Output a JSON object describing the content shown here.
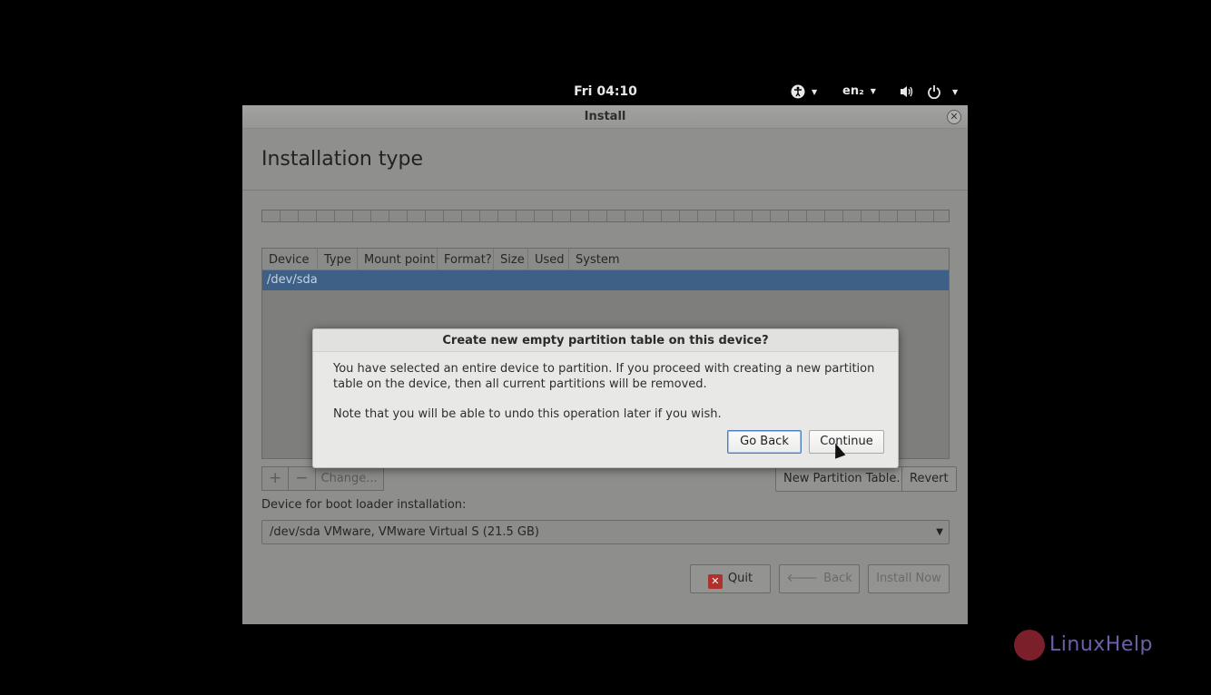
{
  "topbar": {
    "clock": "Fri 04:10",
    "language": "en₂",
    "icons": [
      "accessibility-icon",
      "volume-icon",
      "power-icon"
    ]
  },
  "window": {
    "title": "Install",
    "page_title": "Installation type"
  },
  "partition_table": {
    "columns": [
      "Device",
      "Type",
      "Mount point",
      "Format?",
      "Size",
      "Used",
      "System"
    ],
    "rows": [
      "/dev/sda"
    ]
  },
  "table_buttons": {
    "add": "+",
    "remove": "−",
    "change": "Change...",
    "new_partition_table": "New Partition Table...",
    "revert": "Revert"
  },
  "boot_loader": {
    "label": "Device for boot loader installation:",
    "selected": "/dev/sda  VMware, VMware Virtual S (21.5 GB)"
  },
  "nav_buttons": {
    "quit": "Quit",
    "back": "Back",
    "install_now": "Install Now"
  },
  "dialog": {
    "title": "Create new empty partition table on this device?",
    "body": "You have selected an entire device to partition. If you proceed with creating a new partition table on the device, then all current partitions will be removed.",
    "note": "Note that you will be able to undo this operation later if you wish.",
    "go_back": "Go Back",
    "continue": "Continue"
  },
  "watermark": {
    "text": "LinuxHelp"
  },
  "colors": {
    "selection": "#3e5f86",
    "quit_icon": "#b0302b",
    "focus_border": "#4a7bbd"
  }
}
